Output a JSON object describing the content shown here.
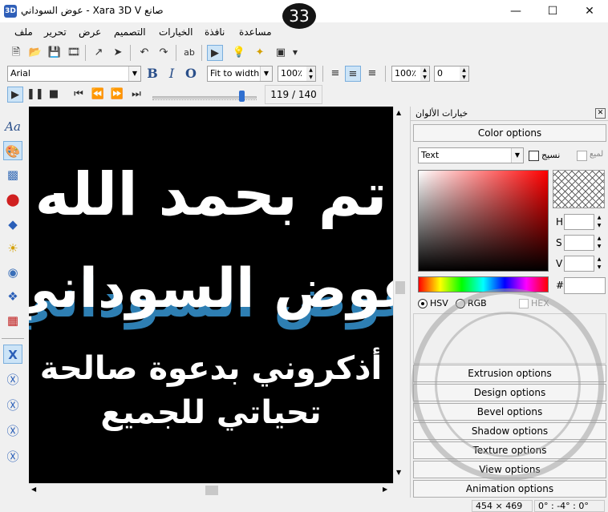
{
  "window": {
    "title": "عوض السوداني - Xara 3D V صانع",
    "app_icon": "3D",
    "badge": "33",
    "controls": [
      "minimize-icon",
      "maximize-icon",
      "close-icon"
    ]
  },
  "menu": {
    "items": [
      "ملف",
      "تحرير",
      "عرض",
      "التصميم",
      "الخيارات",
      "نافذة",
      "مساعدة"
    ]
  },
  "toolbar": {
    "font_name": "Arial",
    "view_mode": "Fit to width",
    "size_percent": "100٪",
    "spacing_percent": "100٪",
    "offset_value": "0",
    "icons": [
      "new-icon",
      "open-icon",
      "save-icon",
      "export-icon",
      "import-icon",
      "export-anim-icon",
      "undo-icon",
      "redo-icon",
      "spell-icon",
      "play-anim-icon",
      "light-icon",
      "wand-icon",
      "frame-icon"
    ],
    "format_buttons": {
      "bold": "B",
      "italic": "I",
      "outline": "O"
    }
  },
  "playback": {
    "frame_counter": "119 / 140",
    "frame_current": 119,
    "frame_total": 140
  },
  "canvas": {
    "line1": "تم بحمد الله",
    "line2": "عوض السوداني",
    "line3": "أذكروني بدعوة صالحة",
    "line4": "تحياتي للجميع",
    "background": "#000000",
    "text_color": "#ffffff",
    "extrude_color": "#2e7fb3"
  },
  "panel": {
    "title": "خيارات الألوان",
    "header_button": "Color options",
    "target_select": "Text",
    "texture_label": "نسيج",
    "flat_label": "لميع",
    "hsv_labels": [
      "H",
      "S",
      "V"
    ],
    "hex_prefix": "#",
    "modes": [
      "HSV",
      "RGB",
      "HEX"
    ],
    "selected_mode": "HSV",
    "options": [
      "Extrusion options",
      "Design options",
      "Bevel options",
      "Shadow options",
      "Texture options",
      "View options",
      "Animation options"
    ]
  },
  "status": {
    "dimensions": "454 × 469",
    "rotation": "0° : -4° : 0°"
  }
}
